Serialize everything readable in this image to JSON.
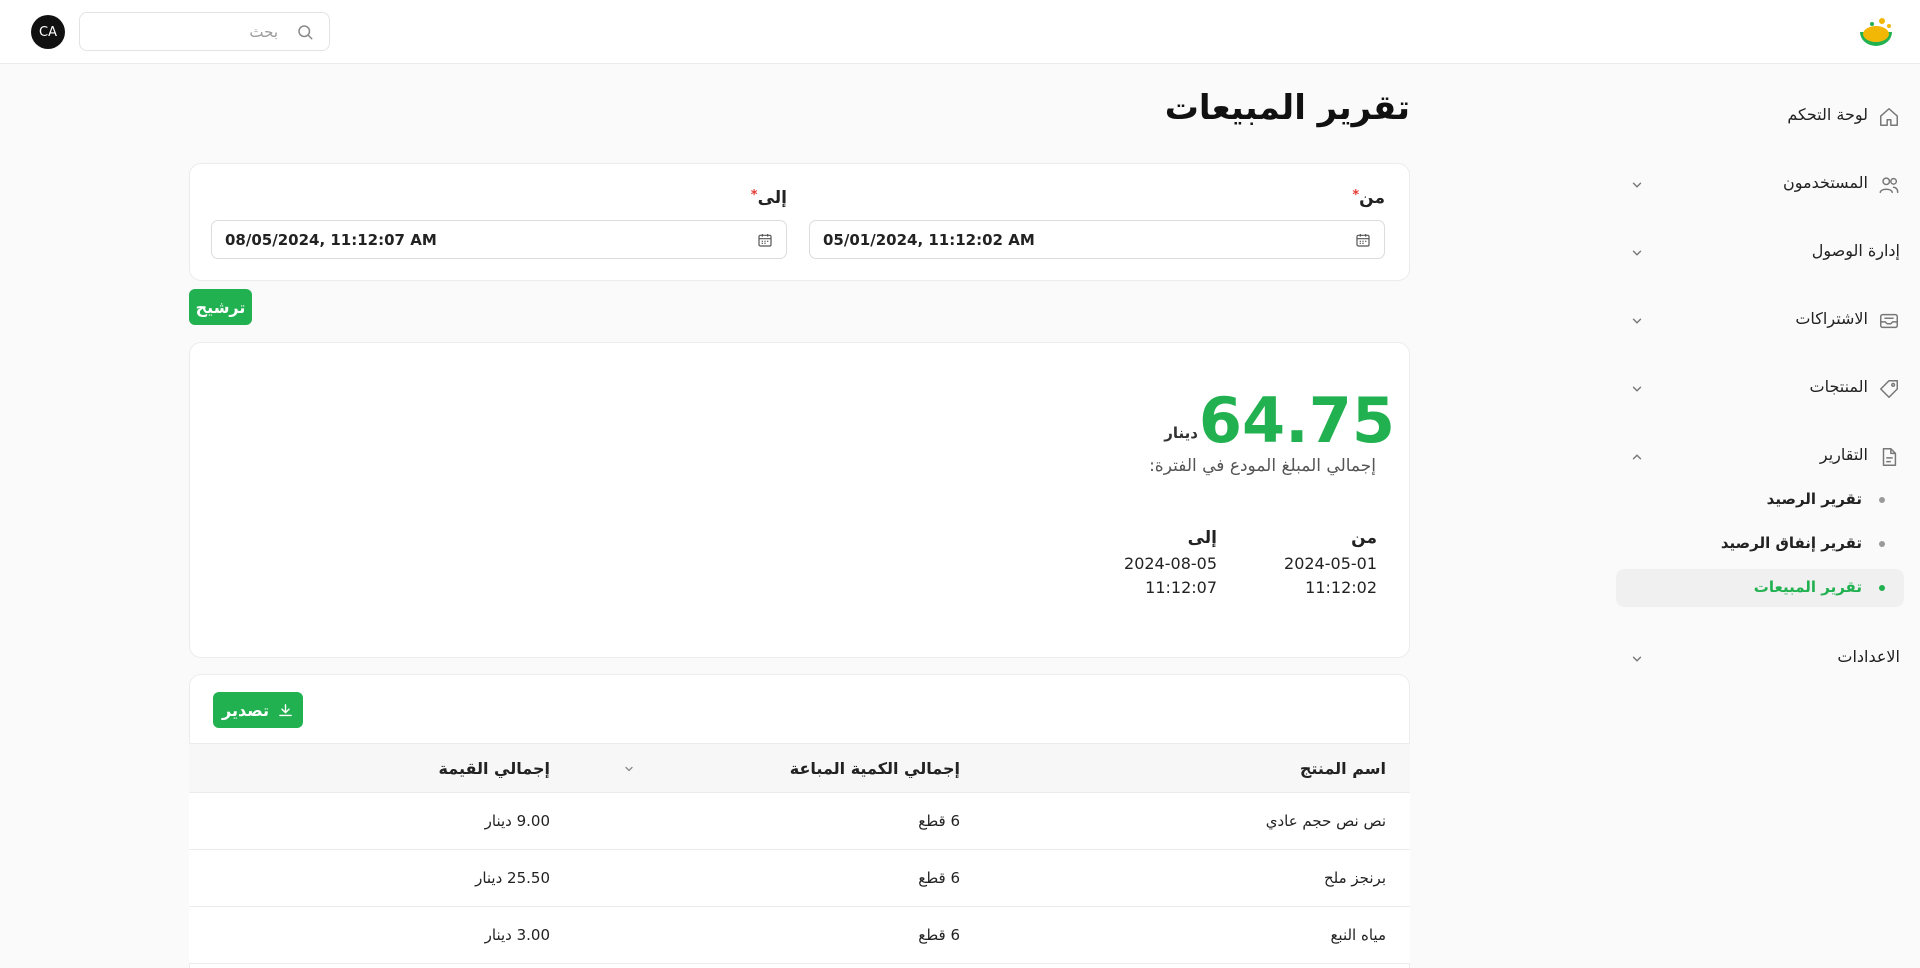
{
  "header": {
    "avatar_initials": "CA",
    "search_placeholder": "بحث",
    "search_icon": "search-icon",
    "logo_icon": "app-logo-icon"
  },
  "sidebar": {
    "items": [
      {
        "label": "لوحة التحكم",
        "icon": "home-icon"
      },
      {
        "label": "المستخدمون",
        "icon": "users-icon"
      },
      {
        "label": "إدارة الوصول",
        "icon": ""
      },
      {
        "label": "الاشتراكات",
        "icon": "inbox-icon"
      },
      {
        "label": "المنتجات",
        "icon": "tag-icon"
      },
      {
        "label": "التقارير",
        "icon": "file-icon"
      },
      {
        "label": "الاعدادات",
        "icon": ""
      }
    ],
    "reports_sub": [
      {
        "label": "تقرير الرصيد"
      },
      {
        "label": "تقرير إنفاق الرصيد"
      },
      {
        "label": "تقرير المبيعات"
      }
    ]
  },
  "main": {
    "title": "تقرير المبيعات",
    "filter": {
      "from_label": "من",
      "from_value": "05/01/2024, 11:12:02 AM",
      "to_label": "إلى",
      "to_value": "08/05/2024, 11:12:07 AM",
      "required_mark": "*",
      "filter_button": "ترشيح"
    },
    "summary": {
      "amount": "64.75",
      "currency": "دينار",
      "label": "إجمالي المبلغ المودع في الفترة:",
      "from_label": "من",
      "from_date": "2024-05-01",
      "from_time": "11:12:02",
      "to_label": "إلى",
      "to_date": "2024-08-05",
      "to_time": "11:12:07"
    },
    "export_button": "تصدير",
    "table": {
      "columns": [
        "اسم المنتج",
        "إجمالي الكمية المباعة",
        "إجمالي القيمة"
      ],
      "rows": [
        {
          "name": "نص نص حجم عادي",
          "qty": "6 قطع",
          "total": "9.00 دينار"
        },
        {
          "name": "برنجز ملح",
          "qty": "6 قطع",
          "total": "25.50 دينار"
        },
        {
          "name": "مياه النبع",
          "qty": "6 قطع",
          "total": "3.00 دينار"
        }
      ]
    }
  },
  "colors": {
    "accent": "#22b150",
    "required": "#e53935"
  }
}
